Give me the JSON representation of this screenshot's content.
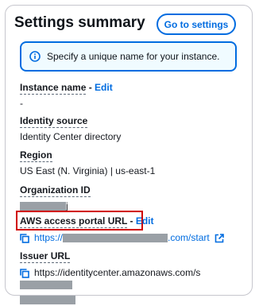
{
  "panel": {
    "title": "Settings summary",
    "go_button": "Go to settings",
    "info_text": "Specify a unique name for your instance."
  },
  "instance_name": {
    "label": "Instance name",
    "separator": " - ",
    "edit": "Edit",
    "value": "-"
  },
  "identity_source": {
    "label": "Identity source",
    "value": "Identity Center directory"
  },
  "region": {
    "label": "Region",
    "value": "US East (N. Virginia) | us-east-1"
  },
  "organization_id": {
    "label": "Organization ID",
    "value_suffix": "j"
  },
  "portal_url": {
    "label": "AWS access portal URL",
    "separator": " - ",
    "edit": "Edit",
    "value_prefix": "https://",
    "value_suffix": ".com/start"
  },
  "issuer_url": {
    "label": "Issuer URL",
    "value_prefix": "https://identitycenter.amazonaws.com/s"
  },
  "colors": {
    "accent": "#006ce0",
    "highlight": "#d00000",
    "info_bg": "#f0fbff"
  }
}
